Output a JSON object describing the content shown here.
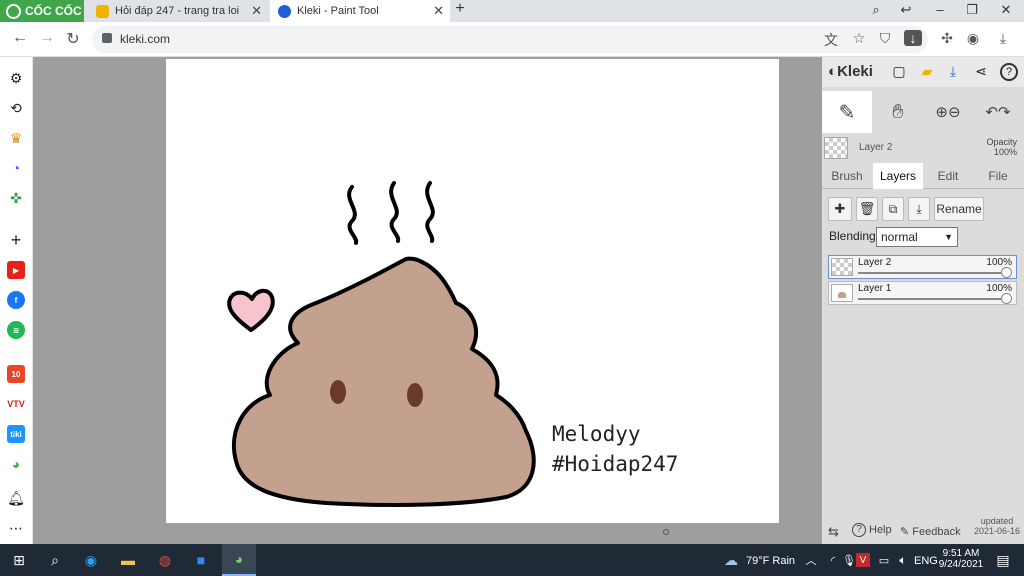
{
  "browser": {
    "brand": "CỐC CỐC",
    "tabs": [
      {
        "title": "Hỏi đáp 247 - trang tra loi",
        "icon": "hoidap-favicon"
      },
      {
        "title": "Kleki - Paint Tool",
        "icon": "kleki-favicon"
      }
    ],
    "url": "kleki.com"
  },
  "kleki": {
    "logo_text": "Kleki",
    "current_layer": "Layer 2",
    "opacity_label": "Opacity",
    "opacity_value": "100%",
    "panel_tabs": [
      "Brush",
      "Layers",
      "Edit",
      "File"
    ],
    "active_tab": "Layers",
    "rename_label": "Rename",
    "blending_label": "Blending",
    "blending_value": "normal",
    "layers": [
      {
        "name": "Layer 2",
        "opacity": "100%",
        "opacity_fraction": 1.0
      },
      {
        "name": "Layer 1",
        "opacity": "100%",
        "opacity_fraction": 1.0
      }
    ],
    "help_label": "Help",
    "feedback_label": "Feedback",
    "updated_label": "updated",
    "updated_date": "2021-06-16"
  },
  "canvas": {
    "text_line1": "Melodyy",
    "text_line2": "#Hoidap247"
  },
  "taskbar": {
    "weather": "79°F  Rain",
    "language": "ENG",
    "time": "9:51 AM",
    "date": "9/24/2021"
  },
  "colors": {
    "poop_fill": "#c4a08e",
    "heart_fill": "#f5c4cc",
    "eye": "#6b3a2a",
    "brand_green": "#3fa64a"
  }
}
